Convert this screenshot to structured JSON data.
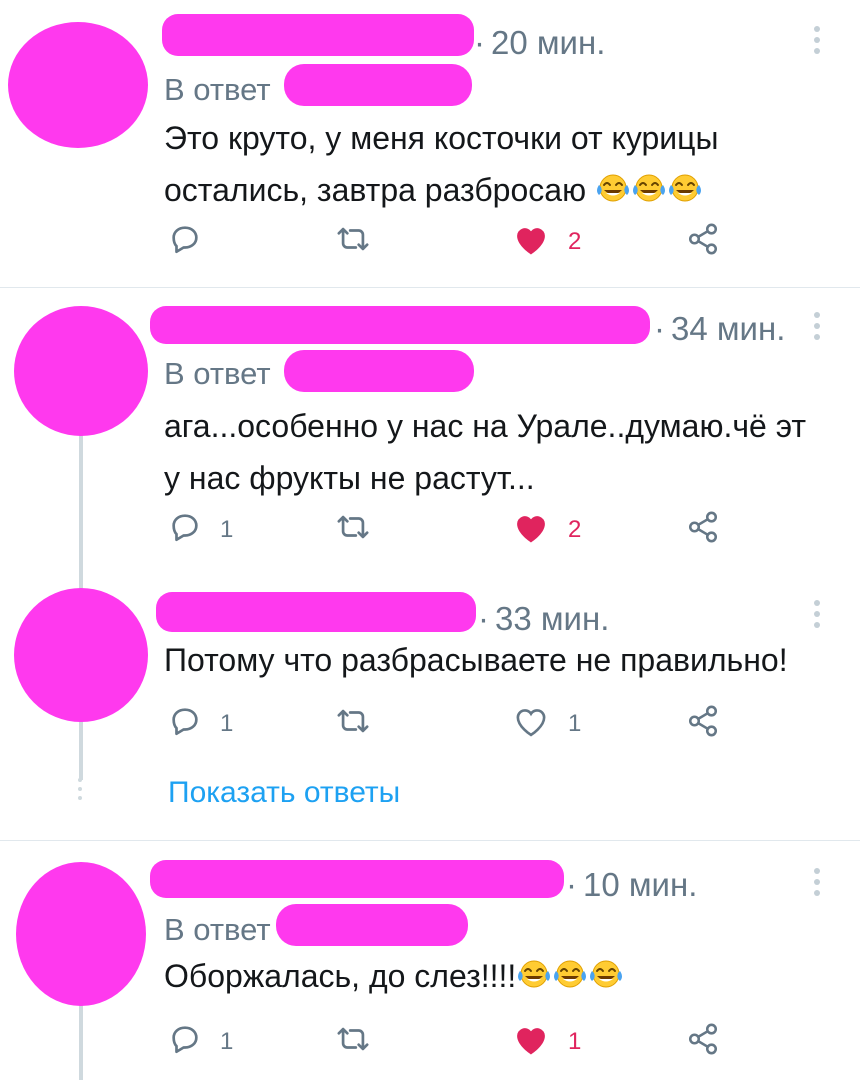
{
  "tweets": [
    {
      "time": "20 мин.",
      "reply_to": "В ответ",
      "text_lines": [
        "Это круто, у меня косточки от курицы",
        "остались, завтра разбросаю"
      ],
      "emoji_count": 3,
      "replies": "",
      "likes": "2",
      "liked": true
    },
    {
      "time": "34 мин.",
      "reply_to": "В ответ",
      "text_lines": [
        "ага...особенно у нас на Урале..думаю.чё эт",
        "у нас фрукты не растут..."
      ],
      "emoji_count": 0,
      "replies": "1",
      "likes": "2",
      "liked": true
    },
    {
      "time": "33 мин.",
      "reply_to": "",
      "text_lines": [
        "Потому что разбрасываете не правильно!"
      ],
      "emoji_count": 0,
      "replies": "1",
      "likes": "1",
      "liked": false
    },
    {
      "time": "10 мин.",
      "reply_to": "В ответ",
      "text_lines": [
        "Оборжалась, до слез!!!!"
      ],
      "emoji_count": 3,
      "replies": "1",
      "likes": "1",
      "liked": true
    }
  ],
  "show_replies_label": "Показать ответы",
  "icons": {
    "reply": "reply-icon",
    "retweet": "retweet-icon",
    "like": "heart-icon",
    "share": "share-icon",
    "more": "more-vertical-icon",
    "emoji": "face-with-tears-of-joy-icon"
  },
  "colors": {
    "accent": "#1da1f2",
    "like": "#e0245e",
    "muted": "#657786",
    "redaction": "#ff39ee"
  }
}
